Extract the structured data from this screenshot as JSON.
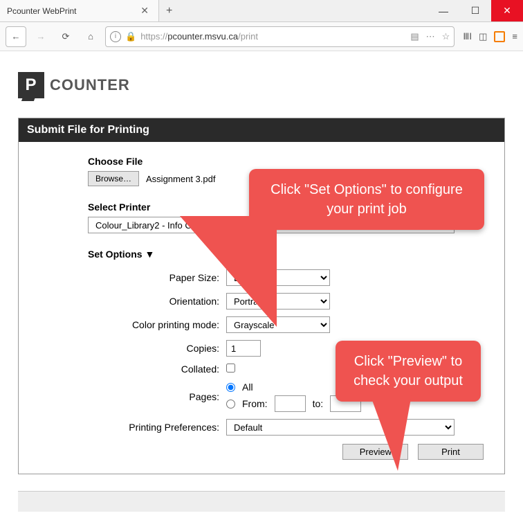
{
  "window": {
    "tab_title": "Pcounter WebPrint",
    "url_prefix": "https://",
    "url_host": "pcounter.msvu.ca",
    "url_path": "/print"
  },
  "logo_text": "COUNTER",
  "panel": {
    "title": "Submit File for Printing",
    "choose_file_label": "Choose File",
    "browse_label": "Browse…",
    "selected_file": "Assignment 3.pdf",
    "select_printer_label": "Select Printer",
    "printer_value": "Colour_Library2 - Info Commons",
    "set_options_label": "Set Options ▼",
    "opts": {
      "paper_size_label": "Paper Size:",
      "paper_size_value": "Letter",
      "orientation_label": "Orientation:",
      "orientation_value": "Portrait",
      "color_mode_label": "Color printing mode:",
      "color_mode_value": "Grayscale",
      "copies_label": "Copies:",
      "copies_value": "1",
      "collated_label": "Collated:",
      "pages_label": "Pages:",
      "pages_all": "All",
      "pages_from": "From:",
      "pages_to": "to:",
      "prefs_label": "Printing Preferences:",
      "prefs_value": "Default"
    },
    "preview_label": "Preview",
    "print_label": "Print"
  },
  "callouts": {
    "c1": "Click \"Set Options\" to configure your print job",
    "c2": "Click \"Preview\" to check your output"
  }
}
